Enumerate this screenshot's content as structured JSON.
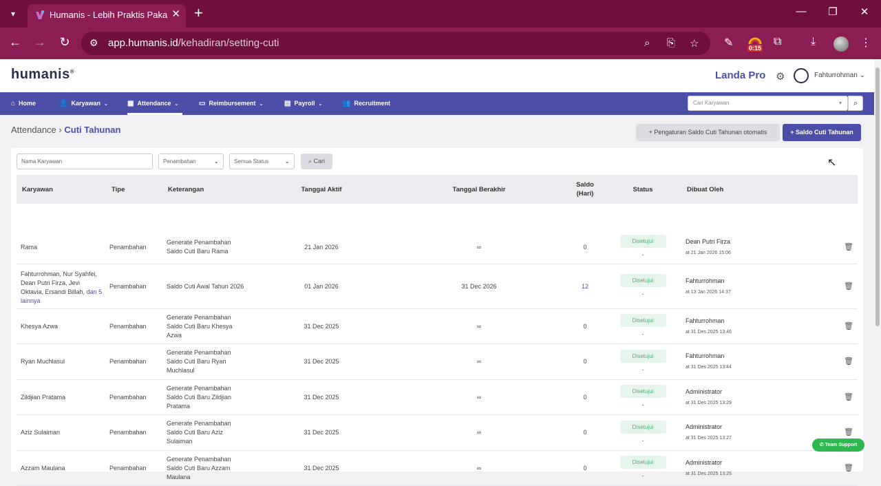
{
  "browser": {
    "tab_title": "Humanis - Lebih Praktis Pakai H",
    "url_host": "app.humanis.id",
    "url_path": "/kehadiran/setting-cuti",
    "timer_badge": "0:15"
  },
  "header": {
    "logo": "humanis",
    "plan": "Landa Pro",
    "user": "Fahturrohman"
  },
  "nav": {
    "home": "Home",
    "karyawan": "Karyawan",
    "attendance": "Attendance",
    "reimbursement": "Reimbursement",
    "payroll": "Payroll",
    "recruitment": "Recruitment",
    "search_placeholder": "Cari Karyawan"
  },
  "page": {
    "crumb_parent": "Attendance",
    "crumb_current": "Cuti Tahunan",
    "btn_auto": "Pengaturan Saldo Cuti Tahunan otomatis",
    "btn_add": "Saldo Cuti Tahunan"
  },
  "filters": {
    "name_placeholder": "Nama Karyawan",
    "type_value": "Penambahan",
    "status_value": "Semua Status",
    "search_btn": "Cari"
  },
  "table": {
    "headers": {
      "karyawan": "Karyawan",
      "tipe": "Tipe",
      "keterangan": "Keterangan",
      "tanggal_aktif": "Tanggal Aktif",
      "tanggal_berakhir": "Tanggal Berakhir",
      "saldo": "Saldo (Hari)",
      "status": "Status",
      "dibuat_oleh": "Dibuat Oleh"
    },
    "rows": [
      {
        "karyawan": "Rama",
        "more": "",
        "tipe": "Penambahan",
        "keterangan": "Generate Penambahan Saldo Cuti Baru Rama",
        "aktif": "21 Jan 2026",
        "berakhir": "∞",
        "saldo": "0",
        "status": "Disetujui",
        "dash": "-",
        "by": "Dean Putri Firza",
        "at": "at 21 Jan 2026 15:06"
      },
      {
        "karyawan": "Fahturrohman, Nur Syahfei, Dean Putri Firza, Jevi Oktavia, Ersandi Billah,",
        "more": "dan 5 lainnya",
        "tipe": "Penambahan",
        "keterangan": "Saldo Cuti Awal Tahun 2026",
        "aktif": "01 Jan 2026",
        "berakhir": "31 Dec 2026",
        "saldo": "12",
        "status": "Disetujui",
        "dash": "-",
        "by": "Fahturrohman",
        "at": "at 13 Jan 2026 14:37"
      },
      {
        "karyawan": "Khesya Azwa",
        "more": "",
        "tipe": "Penambahan",
        "keterangan": "Generate Penambahan Saldo Cuti Baru Khesya Azwa",
        "aktif": "31 Dec 2025",
        "berakhir": "∞",
        "saldo": "0",
        "status": "Disetujui",
        "dash": "-",
        "by": "Fahturrohman",
        "at": "at 31 Des 2025 13:46"
      },
      {
        "karyawan": "Ryan Muchlasul",
        "more": "",
        "tipe": "Penambahan",
        "keterangan": "Generate Penambahan Saldo Cuti Baru Ryan Muchlasul",
        "aktif": "31 Dec 2025",
        "berakhir": "∞",
        "saldo": "0",
        "status": "Disetujui",
        "dash": "-",
        "by": "Fahturrohman",
        "at": "at 31 Des 2025 13:44"
      },
      {
        "karyawan": "Zildjian Pratama",
        "more": "",
        "tipe": "Penambahan",
        "keterangan": "Generate Penambahan Saldo Cuti Baru Zildjian Pratama",
        "aktif": "31 Dec 2025",
        "berakhir": "∞",
        "saldo": "0",
        "status": "Disetujui",
        "dash": "-",
        "by": "Administrator",
        "at": "at 31 Des 2025 13:29"
      },
      {
        "karyawan": "Aziz Sulaiman",
        "more": "",
        "tipe": "Penambahan",
        "keterangan": "Generate Penambahan Saldo Cuti Baru Aziz Sulaiman",
        "aktif": "31 Dec 2025",
        "berakhir": "∞",
        "saldo": "0",
        "status": "Disetujui",
        "dash": "-",
        "by": "Administrator",
        "at": "at 31 Des 2025 13:27"
      },
      {
        "karyawan": "Azzam Maulana",
        "more": "",
        "tipe": "Penambahan",
        "keterangan": "Generate Penambahan Saldo Cuti Baru Azzam Maulana",
        "aktif": "31 Dec 2025",
        "berakhir": "∞",
        "saldo": "0",
        "status": "Disetujui",
        "dash": "-",
        "by": "Administrator",
        "at": "at 31 Des 2025 13:25"
      }
    ]
  },
  "support": "Team Support"
}
